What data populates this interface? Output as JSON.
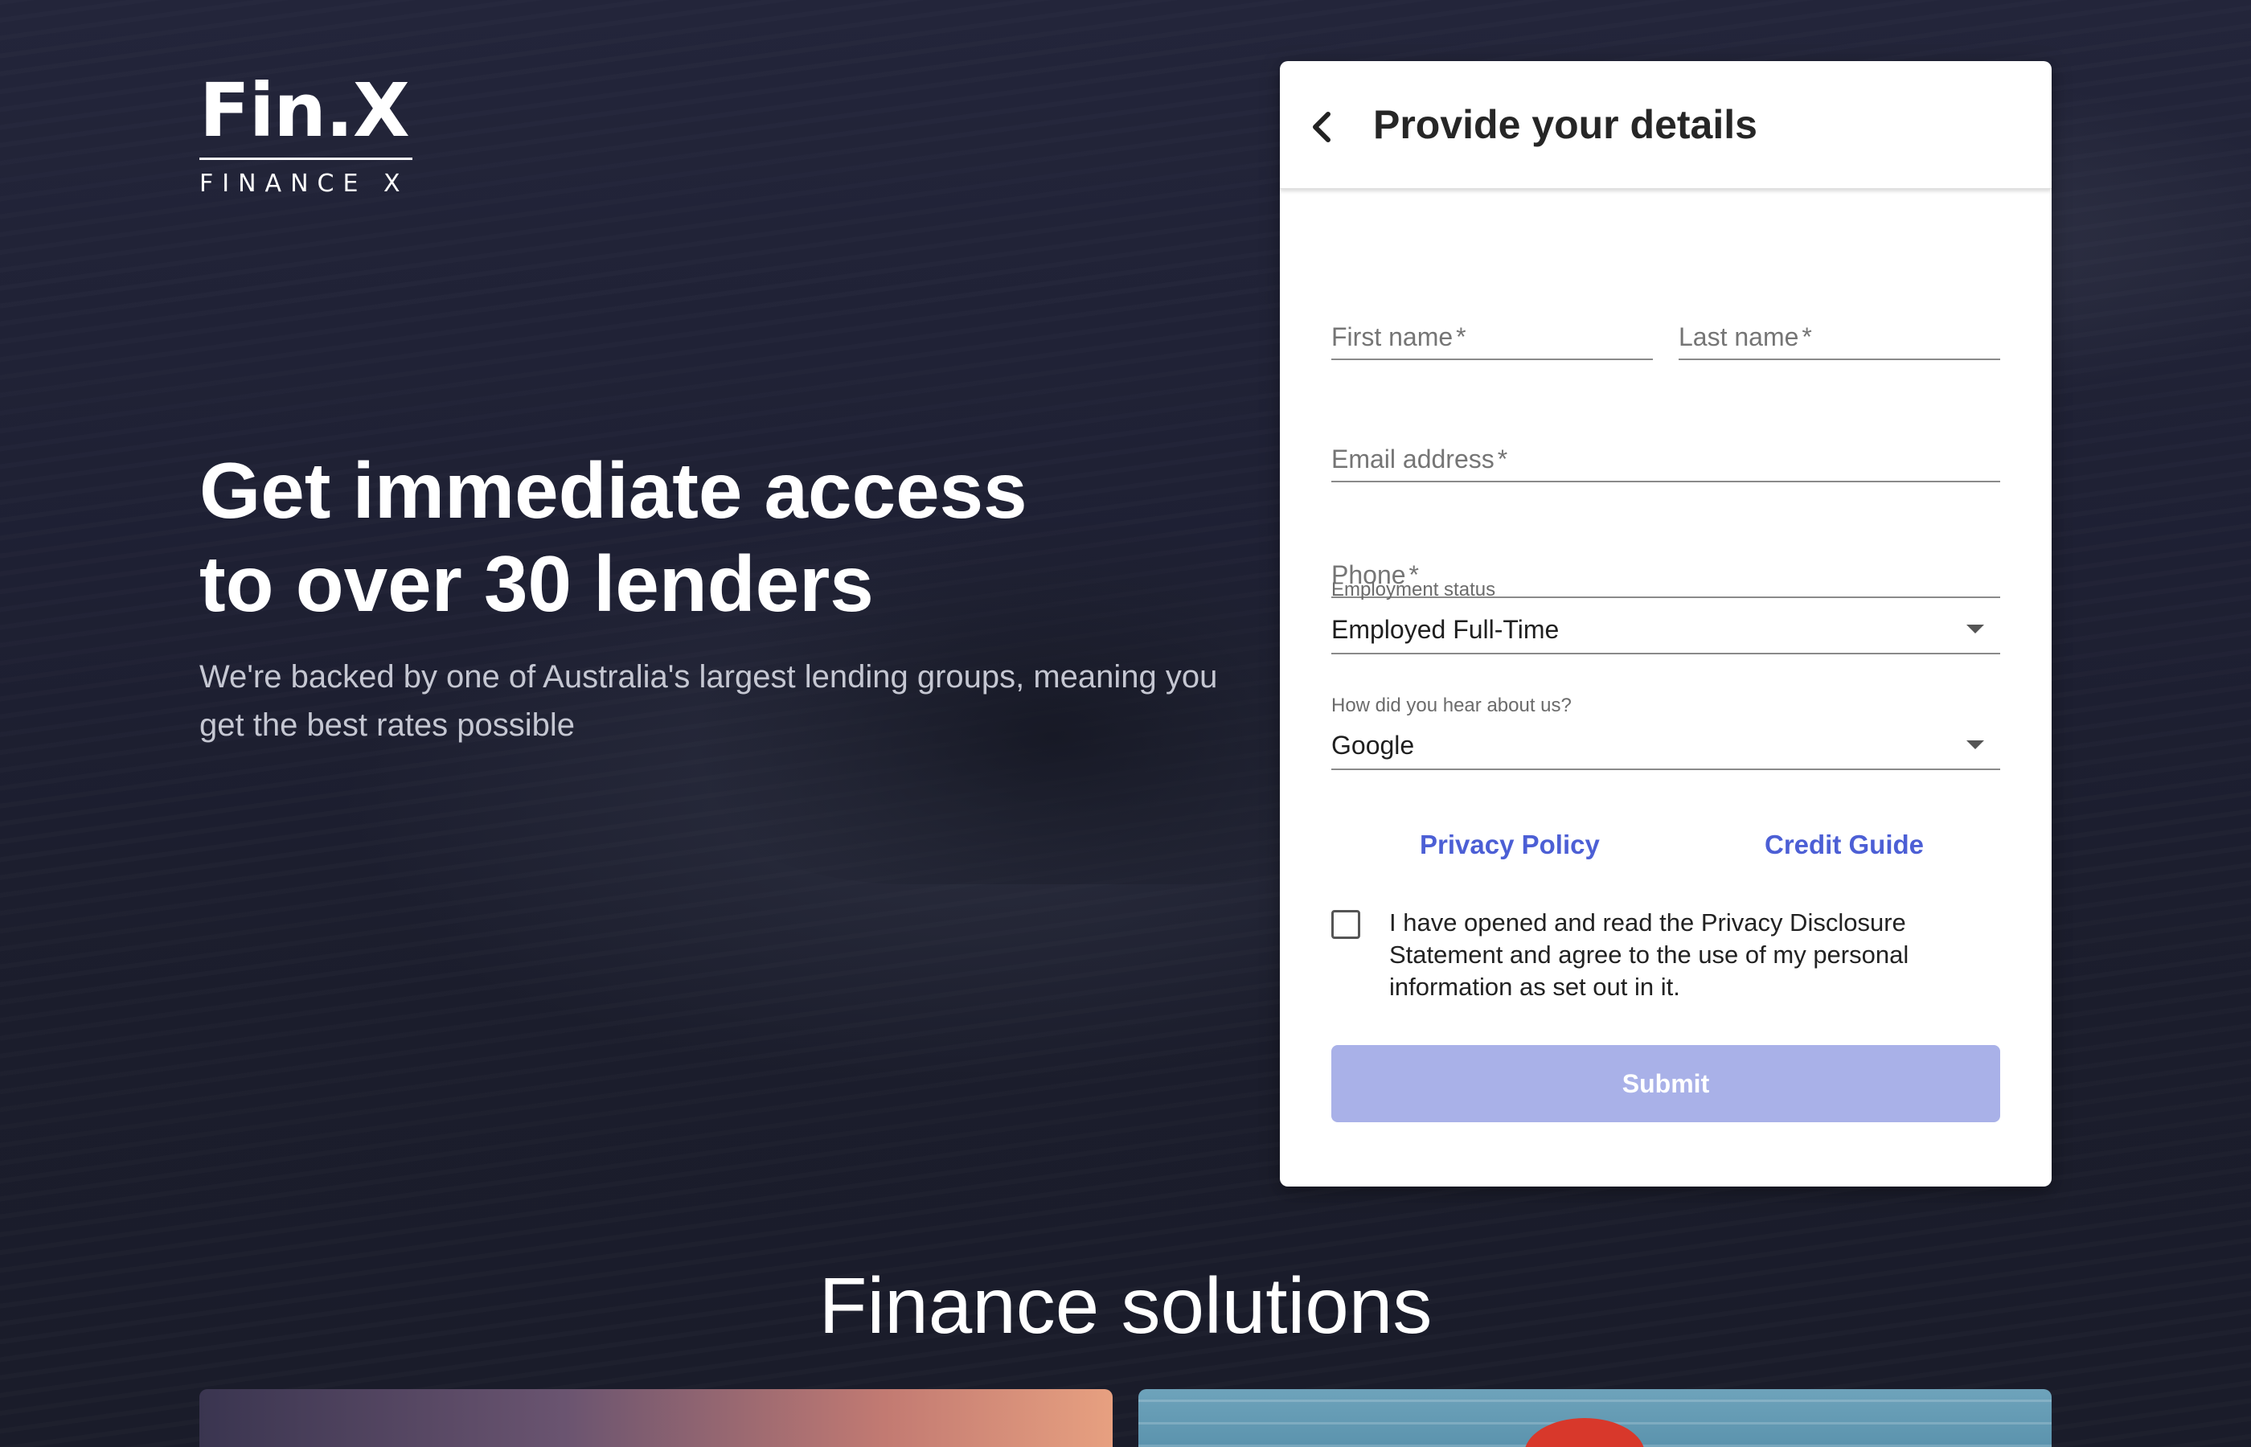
{
  "brand": {
    "logo_mark": "Fin.X",
    "logo_sub": "FINANCE X"
  },
  "hero": {
    "headline_line1": "Get immediate access",
    "headline_line2": "to over 30 lenders",
    "subtext": "We're backed by one of Australia's largest lending groups, meaning you get the best rates possible"
  },
  "form": {
    "title": "Provide your details",
    "first_name_label": "First name",
    "last_name_label": "Last name",
    "email_label": "Email address",
    "phone_label": "Phone",
    "required_mark": "*",
    "employment_label": "Employment status",
    "employment_value": "Employed Full-Time",
    "referral_label": "How did you hear about us?",
    "referral_value": "Google",
    "privacy_link": "Privacy Policy",
    "credit_link": "Credit Guide",
    "consent_text": "I have opened and read the Privacy Disclosure Statement and agree to the use of my personal information as set out in it.",
    "consent_checked": false,
    "submit_label": "Submit"
  },
  "section": {
    "title": "Finance solutions"
  },
  "colors": {
    "background": "#1b1d2b",
    "link": "#4c5fd5",
    "submit_disabled": "#a9b1e8"
  },
  "icons": {
    "back": "chevron-left-icon",
    "dropdown": "caret-down-icon"
  }
}
